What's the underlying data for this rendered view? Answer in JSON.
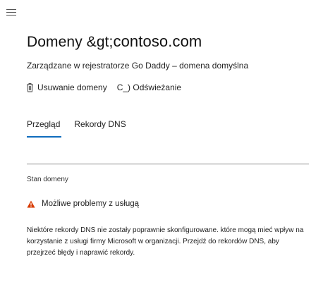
{
  "header": {
    "menu_icon": "hamburger-menu-icon",
    "title_prefix": "Domeny &gt;",
    "title_domain": "contoso.com",
    "subtitle": "Zarządzane w  rejestratorze Go Daddy – domena domyślna"
  },
  "actions": {
    "delete_icon": "trash-icon",
    "delete_label": "Usuwanie domeny",
    "refresh_label": "C_) Odświeżanie"
  },
  "tabs": [
    {
      "label": "Przegląd",
      "selected": true
    },
    {
      "label": "Rekordy DNS",
      "selected": false
    }
  ],
  "domain_status": {
    "section_label": "Stan domeny",
    "warning_icon": "warning-triangle-icon",
    "warning_color": "#d83b01",
    "warning_text": "Możliwe problemy z usługą",
    "description": "Niektóre rekordy DNS nie zostały poprawnie skonfigurowane. które mogą mieć wpływ na korzystanie z usługi firmy Microsoft w organizacji. Przejdź do rekordów DNS, aby przejrzeć błędy i naprawić rekordy."
  },
  "colors": {
    "accent": "#0f6cbd",
    "divider": "#8a8a8a"
  }
}
